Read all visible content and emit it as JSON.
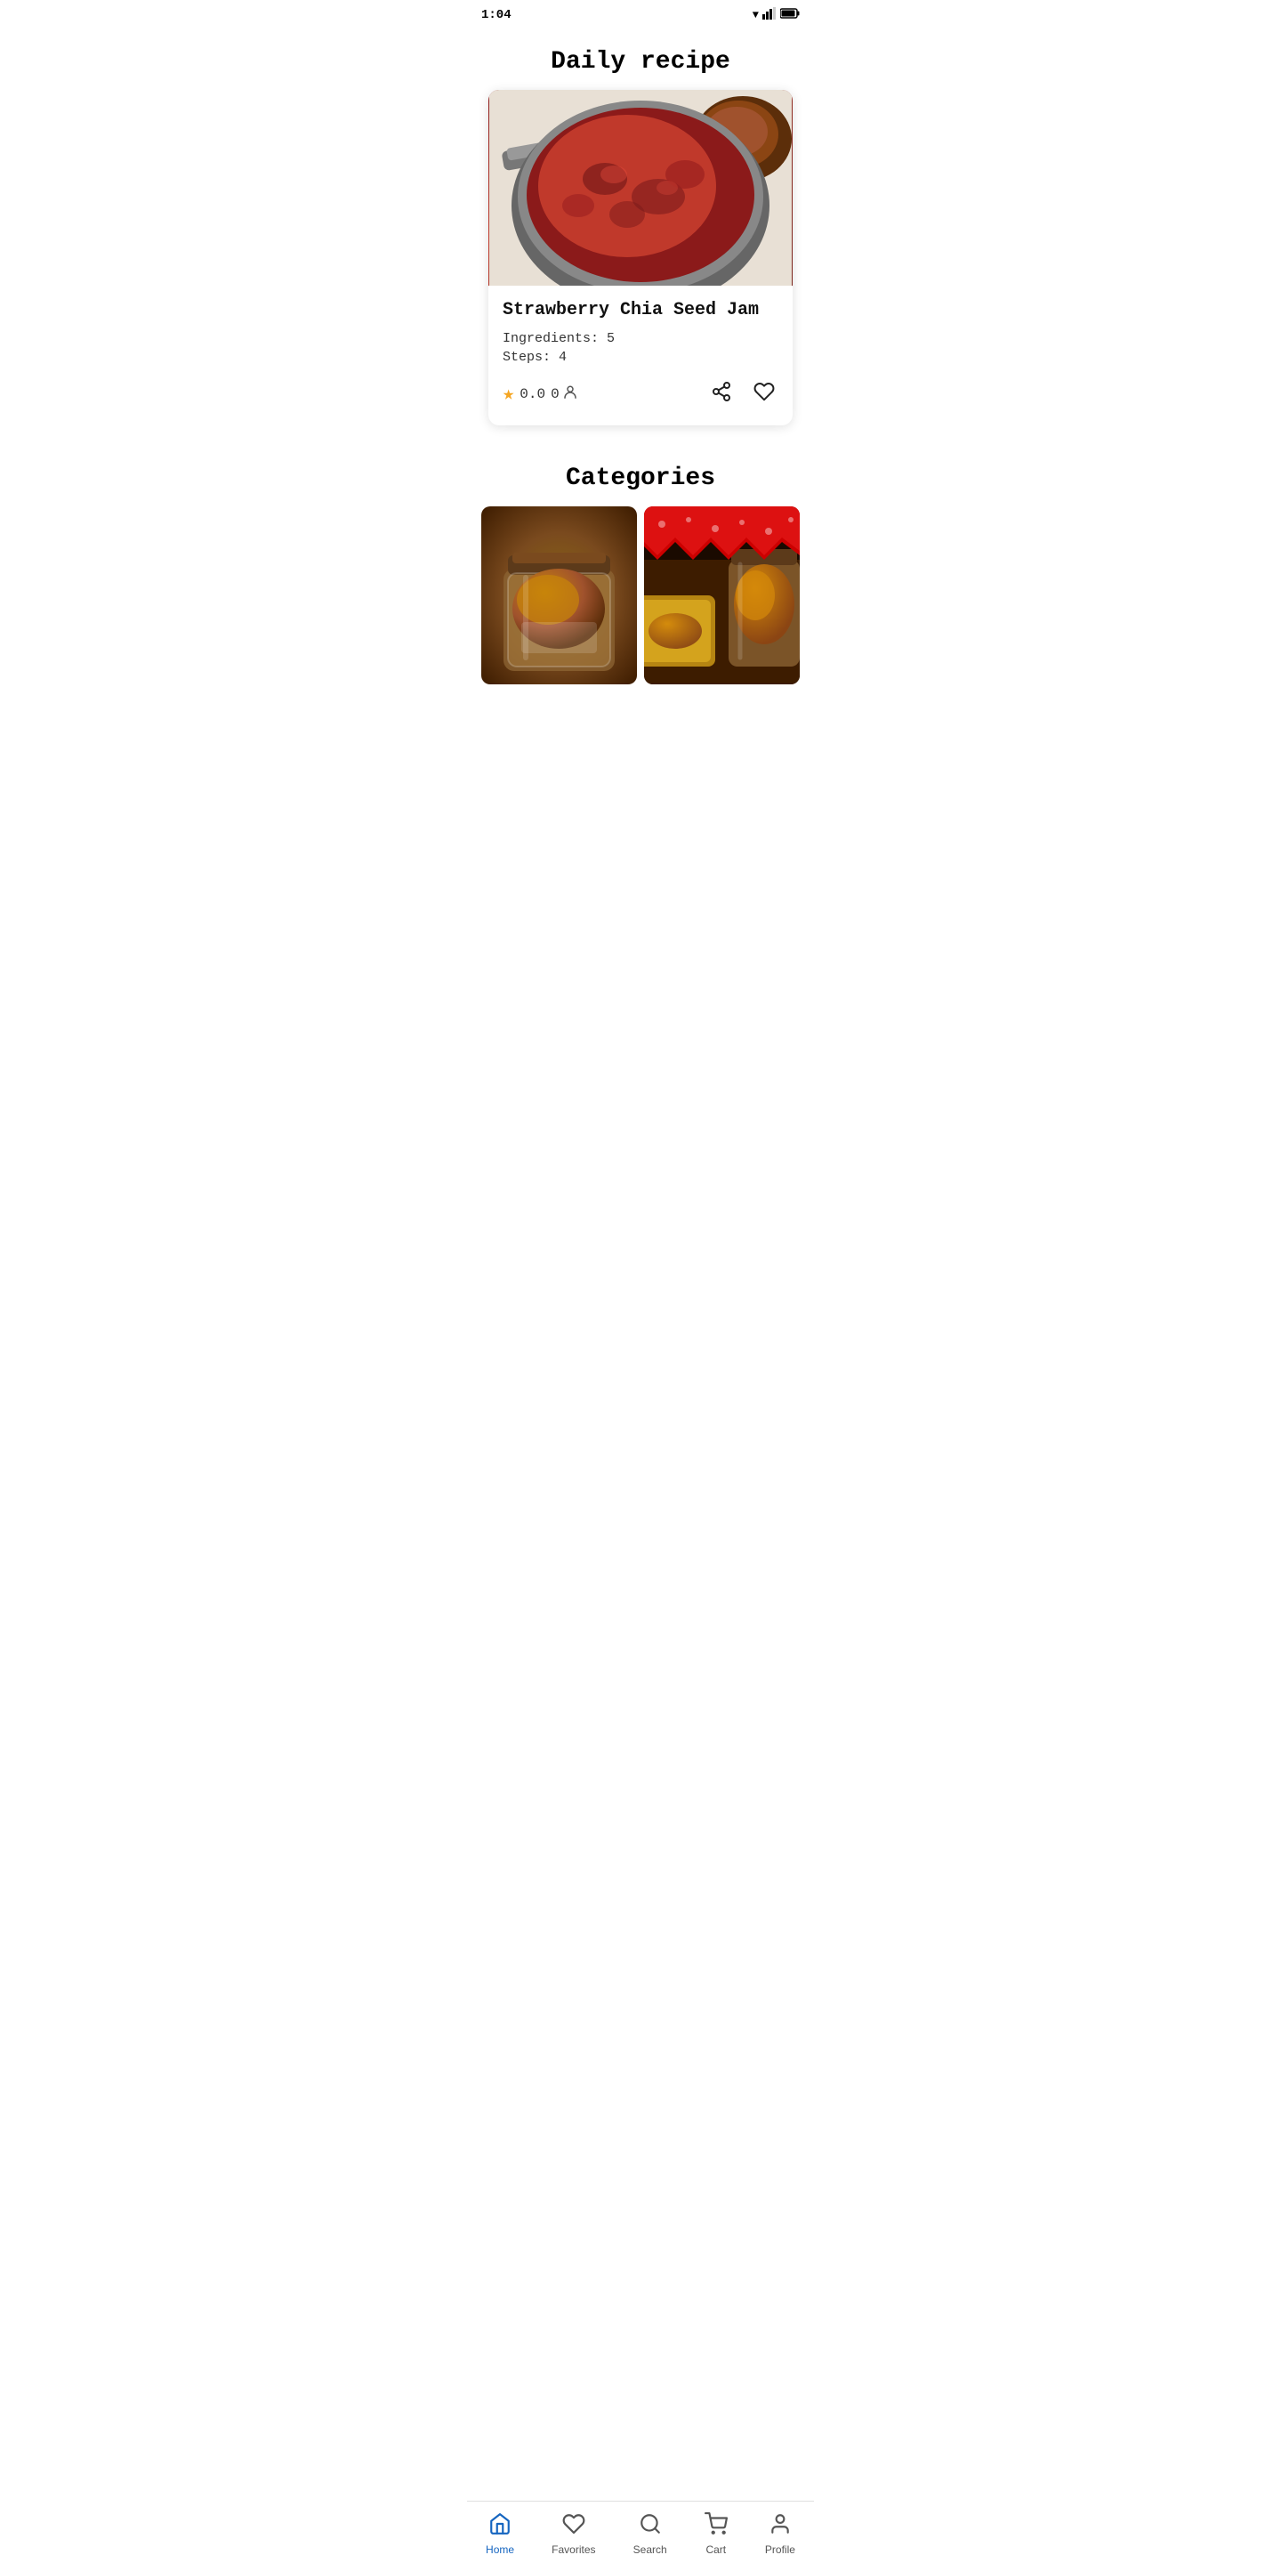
{
  "statusBar": {
    "time": "1:04",
    "wifi": "▼",
    "signal": "▲",
    "battery": "🔋"
  },
  "header": {
    "title": "Daily recipe"
  },
  "recipeCard": {
    "name": "Strawberry Chia Seed Jam",
    "ingredients_label": "Ingredients:",
    "ingredients_count": "5",
    "steps_label": "Steps:",
    "steps_count": "4",
    "rating": "0.0",
    "review_count": "0"
  },
  "categories": {
    "title": "Categories"
  },
  "bottomNav": {
    "home": "Home",
    "favorites": "Favorites",
    "search": "Search",
    "cart": "Cart",
    "profile": "Profile"
  },
  "androidNav": {
    "back": "◀",
    "home": "●",
    "recent": "■"
  }
}
